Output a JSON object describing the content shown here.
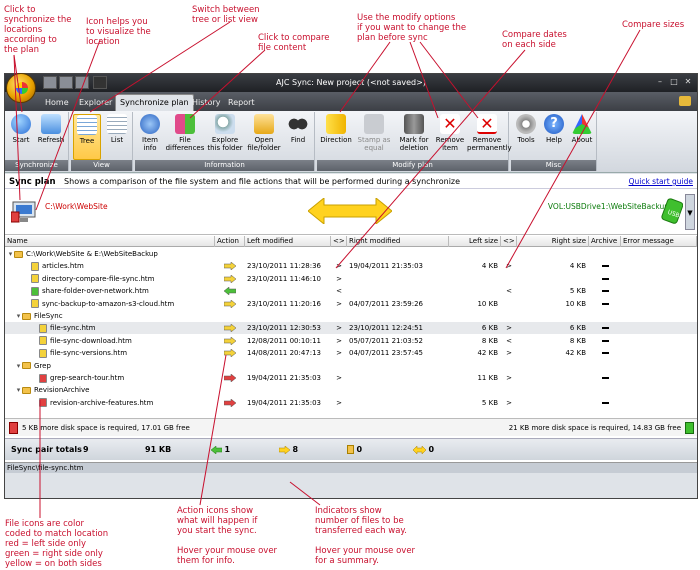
{
  "annotations": {
    "sync_locations": "Click to\nsynchronize the\nlocations\naccording to\nthe plan",
    "icon_visualize": "Icon helps you\nto visualize the\nlocation",
    "switch_view": "Switch between\ntree or list view",
    "compare_content": "Click to compare\nfile content",
    "modify_options": "Use the modify options\nif you want to change the\nplan before sync",
    "compare_dates": "Compare dates\non each side",
    "compare_sizes": "Compare sizes",
    "file_icons": "File icons are color\ncoded to match location\nred = left side only\ngreen = right side only\nyellow = on both sides",
    "action_icons": "Action icons show\nwhat will happen if\nyou start the sync.\n\nHover your mouse over\nthem for info.",
    "indicators": "Indicators show\nnumber of files to be\ntransferred each way.\n\nHover your mouse over\nfor a summary."
  },
  "window": {
    "title": "AJC Sync: New project (<not saved>)"
  },
  "tabs": [
    "Home",
    "Explorer",
    "Synchronize plan",
    "History",
    "Report"
  ],
  "ribbon": {
    "groups": {
      "synchronize": "Synchronize",
      "view": "View",
      "information": "Information",
      "modify": "Modify plan",
      "misc": "Misc"
    },
    "buttons": {
      "start": "Start",
      "refresh": "Refresh",
      "tree": "Tree",
      "list": "List",
      "item_info": "Item\ninfo",
      "file_diff": "File\ndifferences",
      "explore": "Explore\nthis folder",
      "open": "Open\nfile/folder",
      "find": "Find",
      "direction": "Direction",
      "stamp": "Stamp as\nequal",
      "mark_delete": "Mark for\ndeletion",
      "remove_item": "Remove\nitem",
      "remove_perm": "Remove\npermanently",
      "tools": "Tools",
      "help": "Help",
      "about": "About"
    }
  },
  "plan": {
    "title": "Sync plan",
    "description": "Shows a comparison of the file system and file actions that will be performed during a synchronize",
    "quick_start": "Quick start guide",
    "left_path": "C:\\Work\\WebSite",
    "right_path": "VOL:USBDrive1:\\WebSiteBackup"
  },
  "columns": [
    "Name",
    "Action",
    "Left modified",
    "<>",
    "Right modified",
    "Left size",
    "<>",
    "Right size",
    "Archive",
    "Error message"
  ],
  "rows": [
    {
      "type": "root",
      "name": "C:\\Work\\WebSite & E:\\WebSiteBackup",
      "action": "",
      "lmod": "",
      "cmp": "",
      "rmod": "",
      "lsize": "",
      "scmp": "",
      "rsize": "",
      "archive": false,
      "sel": false,
      "color": ""
    },
    {
      "type": "file",
      "name": "articles.htm",
      "action": "right",
      "lmod": "23/10/2011 11:28:36",
      "cmp": ">",
      "rmod": "19/04/2011 21:35:03",
      "lsize": "4 KB",
      "scmp": ">",
      "rsize": "4 KB",
      "archive": true,
      "sel": false,
      "color": "yellow"
    },
    {
      "type": "file",
      "name": "directory-compare-file-sync.htm",
      "action": "right",
      "lmod": "23/10/2011 11:46:10",
      "cmp": ">",
      "rmod": "",
      "lsize": "",
      "scmp": "",
      "rsize": "",
      "archive": true,
      "sel": false,
      "color": "yellow"
    },
    {
      "type": "file",
      "name": "share-folder-over-network.htm",
      "action": "left",
      "lmod": "",
      "cmp": "<",
      "rmod": "",
      "lsize": "",
      "scmp": "<",
      "rsize": "5 KB",
      "archive": true,
      "sel": false,
      "color": "green"
    },
    {
      "type": "file",
      "name": "sync-backup-to-amazon-s3-cloud.htm",
      "action": "right",
      "lmod": "23/10/2011 11:20:16",
      "cmp": ">",
      "rmod": "04/07/2011 23:59:26",
      "lsize": "10 KB",
      "scmp": "",
      "rsize": "10 KB",
      "archive": true,
      "sel": false,
      "color": "yellow"
    },
    {
      "type": "folder",
      "name": "FileSync",
      "action": "",
      "lmod": "",
      "cmp": "",
      "rmod": "",
      "lsize": "",
      "scmp": "",
      "rsize": "",
      "archive": false,
      "sel": false,
      "color": ""
    },
    {
      "type": "file",
      "name": "file-sync.htm",
      "action": "right",
      "lmod": "23/10/2011 12:30:53",
      "cmp": ">",
      "rmod": "23/10/2011 12:24:51",
      "lsize": "6 KB",
      "scmp": ">",
      "rsize": "6 KB",
      "archive": true,
      "sel": true,
      "color": "yellow"
    },
    {
      "type": "file",
      "name": "file-sync-download.htm",
      "action": "right",
      "lmod": "12/08/2011 00:10:11",
      "cmp": ">",
      "rmod": "05/07/2011 21:03:52",
      "lsize": "8 KB",
      "scmp": "<",
      "rsize": "8 KB",
      "archive": true,
      "sel": false,
      "color": "yellow"
    },
    {
      "type": "file",
      "name": "file-sync-versions.htm",
      "action": "right",
      "lmod": "14/08/2011 20:47:13",
      "cmp": ">",
      "rmod": "04/07/2011 23:57:45",
      "lsize": "42 KB",
      "scmp": ">",
      "rsize": "42 KB",
      "archive": true,
      "sel": false,
      "color": "yellow"
    },
    {
      "type": "folder",
      "name": "Grep",
      "action": "",
      "lmod": "",
      "cmp": "",
      "rmod": "",
      "lsize": "",
      "scmp": "",
      "rsize": "",
      "archive": false,
      "sel": false,
      "color": ""
    },
    {
      "type": "file",
      "name": "grep-search-tour.htm",
      "action": "red",
      "lmod": "19/04/2011 21:35:03",
      "cmp": ">",
      "rmod": "",
      "lsize": "11 KB",
      "scmp": ">",
      "rsize": "",
      "archive": true,
      "sel": false,
      "color": "red"
    },
    {
      "type": "folder",
      "name": "RevisionArchive",
      "action": "",
      "lmod": "",
      "cmp": "",
      "rmod": "",
      "lsize": "",
      "scmp": "",
      "rsize": "",
      "archive": false,
      "sel": false,
      "color": ""
    },
    {
      "type": "file",
      "name": "revision-archive-features.htm",
      "action": "red",
      "lmod": "19/04/2011 21:35:03",
      "cmp": ">",
      "rmod": "",
      "lsize": "5 KB",
      "scmp": ">",
      "rsize": "",
      "archive": true,
      "sel": false,
      "color": "red"
    }
  ],
  "status": {
    "left": "5 KB more disk space is required, 17.01 GB free",
    "right": "21 KB more disk space is required, 14.83 GB free"
  },
  "totals": {
    "label": "Sync pair totals",
    "count": "9",
    "size": "91 KB",
    "to_left": "1",
    "to_right": "8",
    "deleted": "0",
    "conflicts": "0"
  },
  "statusbar": "FileSync\\file-sync.htm",
  "colors": {
    "yellow": "#f4d23a",
    "green": "#4cbf3a",
    "red": "#e04040",
    "accent": "#c8102e"
  }
}
